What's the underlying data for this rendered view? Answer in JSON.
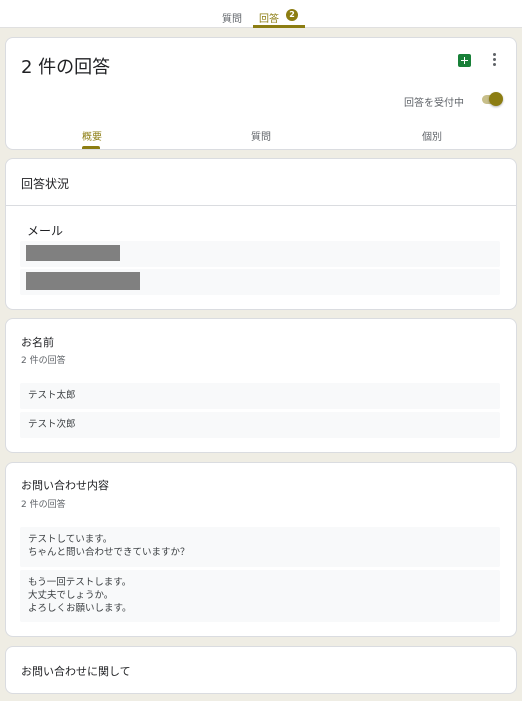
{
  "header": {
    "tabs": [
      {
        "label": "質問"
      },
      {
        "label": "回答",
        "badge": "2"
      }
    ]
  },
  "summary": {
    "title": "2 件の回答",
    "accepting_label": "回答を受付中",
    "accepting": true,
    "subtabs": [
      {
        "label": "概要"
      },
      {
        "label": "質問"
      },
      {
        "label": "個別"
      }
    ]
  },
  "status": {
    "title": "回答状況",
    "email_label": "メール",
    "emails_redacted": 2
  },
  "questions": [
    {
      "title": "お名前",
      "count": "2 件の回答",
      "answers": [
        "テスト太郎",
        "テスト次郎"
      ]
    },
    {
      "title": "お問い合わせ内容",
      "count": "2 件の回答",
      "answers": [
        "テストしています。\nちゃんと問い合わせできていますか？",
        "もう一回テストします。\n大丈夫でしょうか。\nよろしくお願いします。"
      ]
    },
    {
      "title": "お問い合わせに関して"
    }
  ],
  "colors": {
    "accent": "#8c7d12",
    "sheets": "#188038",
    "background": "#efede4"
  }
}
